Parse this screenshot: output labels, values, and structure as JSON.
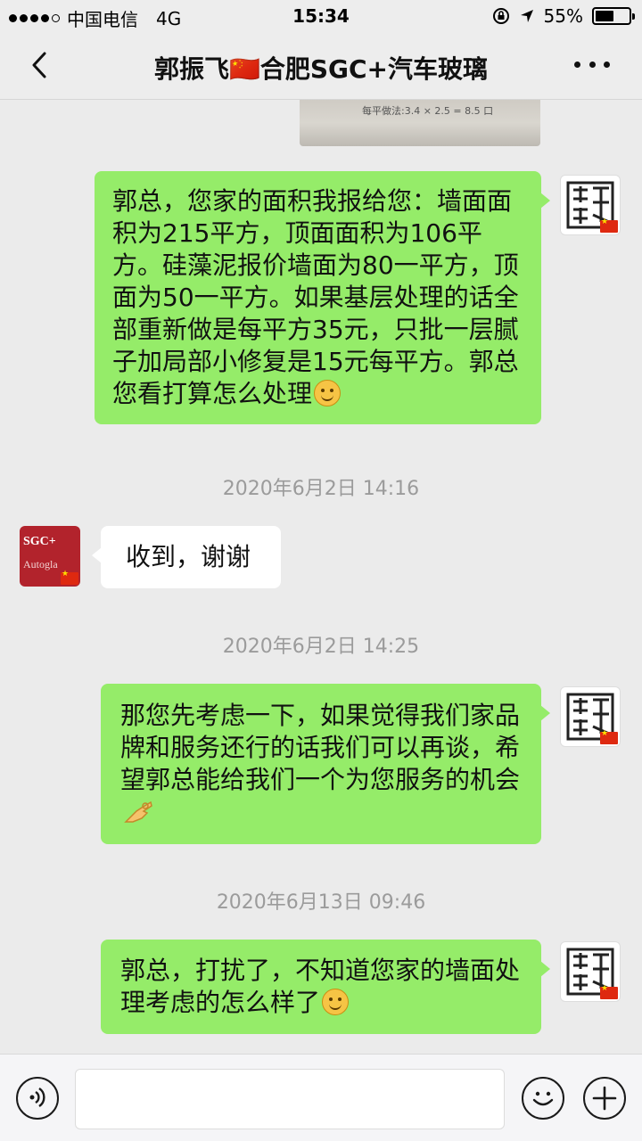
{
  "status_bar": {
    "carrier": "中国电信",
    "network": "4G",
    "time": "15:34",
    "battery_percent": "55%",
    "battery_level": 0.55
  },
  "nav": {
    "title": "郭振飞🇨🇳合肥SGC+汽车玻璃"
  },
  "prev_image": {
    "partial_text": "每平做法:3.4 × 2.5 = 8.5 口"
  },
  "messages": [
    {
      "type": "sent",
      "text": "郭总，您家的面积我报给您：墙面面积为215平方，顶面面积为106平方。硅藻泥报价墙面为80一平方，顶面为50一平方。如果基层处理的话全部重新做是每平方35元，只批一层腻子加局部小修复是15元每平方。郭总您看打算怎么处理",
      "emoji": "smile-emoji"
    },
    {
      "type": "timestamp",
      "text": "2020年6月2日 14:16"
    },
    {
      "type": "received",
      "text": "收到，谢谢"
    },
    {
      "type": "timestamp",
      "text": "2020年6月2日 14:25"
    },
    {
      "type": "sent",
      "text": "那您先考虑一下，如果觉得我们家品牌和服务还行的话我们可以再谈，希望郭总能给我们一个为您服务的机会",
      "emoji": "ok-hand-emoji"
    },
    {
      "type": "timestamp",
      "text": "2020年6月13日 09:46"
    },
    {
      "type": "sent",
      "text": "郭总，打扰了，不知道您家的墙面处理考虑的怎么样了",
      "emoji": "smile-emoji"
    }
  ],
  "avatars": {
    "self_glyph": "蓒",
    "contact_text_top": "SGC+",
    "contact_text_bottom": "Autogla"
  },
  "input_bar": {
    "placeholder": ""
  },
  "colors": {
    "background": "#ebebeb",
    "sent_bubble": "#95ec69",
    "received_bubble": "#ffffff",
    "timestamp": "#9b9b9b",
    "contact_avatar": "#b2232c"
  }
}
